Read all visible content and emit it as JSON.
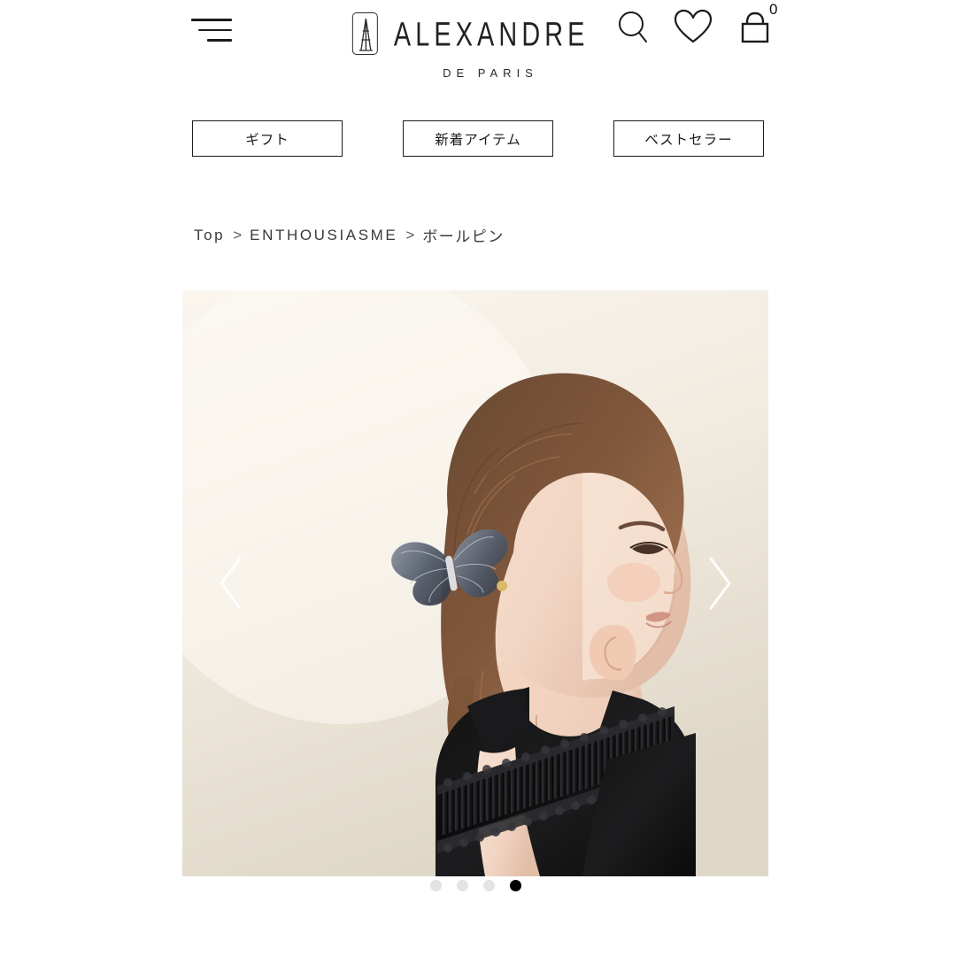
{
  "header": {
    "menu_label": "menu",
    "logo": {
      "mark": "eiffel-tower-logo",
      "wordmark": "ALEXANDRE",
      "subtitle": "DE PARIS"
    },
    "icons": {
      "search": "search-icon",
      "wishlist": "heart-icon",
      "cart": "shopping-bag-icon"
    },
    "cart_count": "0"
  },
  "category_nav": {
    "items": [
      {
        "label": "ギフト"
      },
      {
        "label": "新着アイテム"
      },
      {
        "label": "ベストセラー"
      }
    ]
  },
  "breadcrumb": {
    "separator": ">",
    "items": [
      {
        "label": "Top"
      },
      {
        "label": "ENTHOUSIASME"
      },
      {
        "label": "ボールピン"
      }
    ]
  },
  "gallery": {
    "alt": "モデルが黒いバタフライのボールピンを着用",
    "active_index": 3,
    "dots": [
      {
        "label": "1"
      },
      {
        "label": "2"
      },
      {
        "label": "3"
      },
      {
        "label": "4"
      }
    ],
    "prev_label": "前の画像",
    "next_label": "次の画像"
  },
  "colors": {
    "text": "#222222",
    "border": "#1c1c1c",
    "photo_bg": "#f4efe6",
    "dot_inactive": "#e3e3e3",
    "dot_active": "#000000",
    "page_bg": "#ffffff"
  }
}
